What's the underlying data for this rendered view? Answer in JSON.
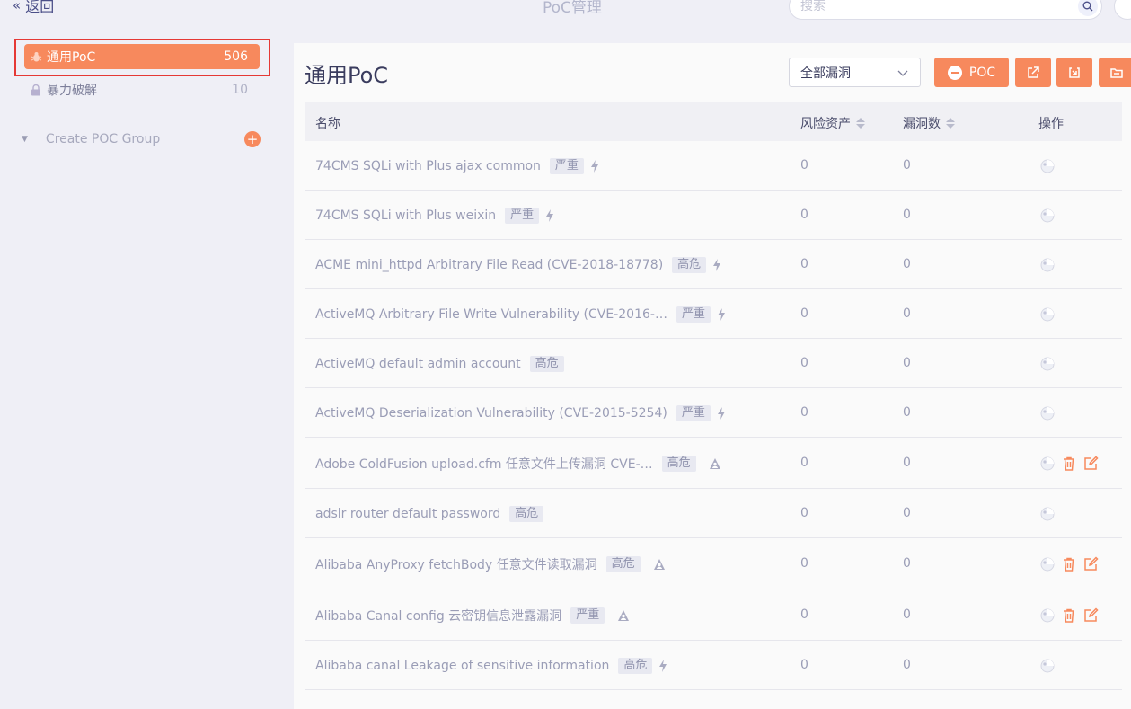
{
  "header": {
    "back_label": "返回",
    "title": "PoC管理",
    "search_placeholder": "搜索"
  },
  "sidebar": {
    "items": [
      {
        "label": "通用PoC",
        "count": "506",
        "icon": "bug-icon",
        "active": true
      },
      {
        "label": "暴力破解",
        "count": "10",
        "icon": "lock-icon",
        "active": false
      }
    ],
    "create_group_label": "Create POC Group"
  },
  "main": {
    "title": "通用PoC",
    "filter_selected": "全部漏洞",
    "add_poc_label": "POC",
    "columns": {
      "name": "名称",
      "risk_assets": "风险资产",
      "vuln_count": "漏洞数",
      "actions": "操作"
    },
    "rows": [
      {
        "name": "74CMS SQLi with Plus ajax common",
        "level": "严重",
        "kind": "lightning-icon",
        "risk": "0",
        "vulns": "0",
        "editable": false
      },
      {
        "name": "74CMS SQLi with Plus weixin",
        "level": "严重",
        "kind": "lightning-icon",
        "risk": "0",
        "vulns": "0",
        "editable": false
      },
      {
        "name": "ACME mini_httpd Arbitrary File Read (CVE-2018-18778)",
        "level": "高危",
        "kind": "lightning-icon",
        "risk": "0",
        "vulns": "0",
        "editable": false
      },
      {
        "name": "ActiveMQ Arbitrary File Write Vulnerability (CVE-2016-…",
        "level": "严重",
        "kind": "lightning-icon",
        "risk": "0",
        "vulns": "0",
        "editable": false
      },
      {
        "name": "ActiveMQ default admin account",
        "level": "高危",
        "kind": "",
        "risk": "0",
        "vulns": "0",
        "editable": false
      },
      {
        "name": "ActiveMQ Deserialization Vulnerability (CVE-2015-5254)",
        "level": "严重",
        "kind": "lightning-icon",
        "risk": "0",
        "vulns": "0",
        "editable": false
      },
      {
        "name": "Adobe ColdFusion upload.cfm 任意文件上传漏洞 CVE-…",
        "level": "高危",
        "kind": "user-icon",
        "risk": "0",
        "vulns": "0",
        "editable": true
      },
      {
        "name": "adslr router default password",
        "level": "高危",
        "kind": "",
        "risk": "0",
        "vulns": "0",
        "editable": false
      },
      {
        "name": "Alibaba AnyProxy fetchBody 任意文件读取漏洞",
        "level": "高危",
        "kind": "user-icon",
        "risk": "0",
        "vulns": "0",
        "editable": true
      },
      {
        "name": "Alibaba Canal config 云密钥信息泄露漏洞",
        "level": "严重",
        "kind": "user-icon",
        "risk": "0",
        "vulns": "0",
        "editable": true
      },
      {
        "name": "Alibaba canal Leakage of sensitive information",
        "level": "高危",
        "kind": "lightning-icon",
        "risk": "0",
        "vulns": "0",
        "editable": false
      }
    ]
  },
  "colors": {
    "accent": "#f7895d",
    "highlight_border": "#e53935",
    "text_title": "#3a3c5e",
    "text_muted": "#9a9db6"
  }
}
